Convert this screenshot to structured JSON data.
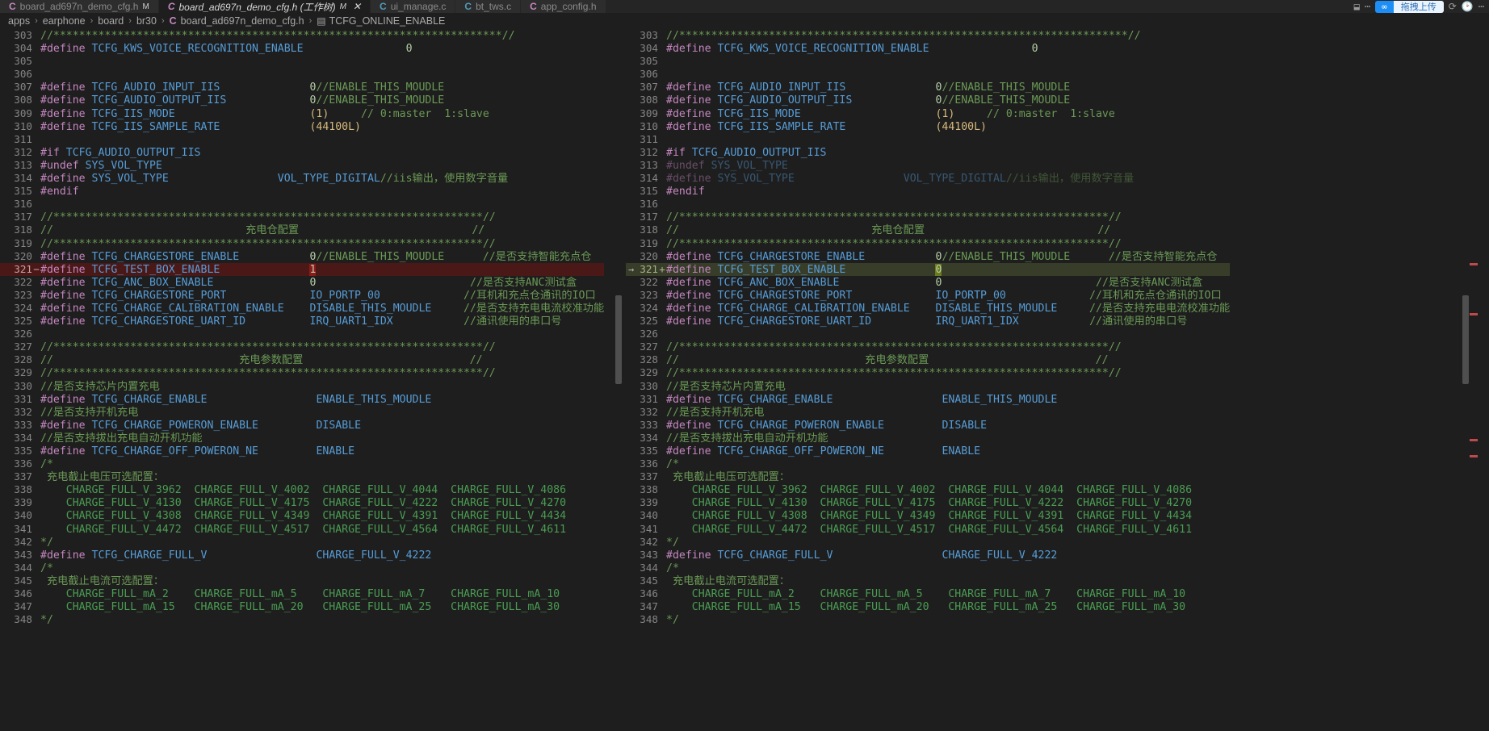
{
  "window": {
    "tabs": [
      {
        "icon": "c-file-icon",
        "label": "board_ad697n_demo_cfg.h",
        "dirty": "M",
        "active": false,
        "closable": false
      },
      {
        "icon": "c-file-icon",
        "label": "board_ad697n_demo_cfg.h (工作树)",
        "dirty": "M",
        "active": true,
        "closable": true,
        "close_label": "✕"
      },
      {
        "icon": "c-file-icon-blue",
        "label": "ui_manage.c",
        "dirty": "",
        "active": false,
        "closable": false
      },
      {
        "icon": "c-file-icon-blue",
        "label": "bt_tws.c",
        "dirty": "",
        "active": false,
        "closable": false
      },
      {
        "icon": "c-file-icon",
        "label": "app_config.h",
        "dirty": "",
        "active": false,
        "closable": false
      }
    ],
    "toolbar": {
      "split_editor_icon": "⬓",
      "more_actions_icon": "⋯",
      "history_icon": "⟳",
      "clock_icon": "🕑",
      "upload_prefix": "∞",
      "upload_label": "拖拽上传"
    }
  },
  "breadcrumb": {
    "separator": "›",
    "items": [
      "apps",
      "earphone",
      "board",
      "br30"
    ],
    "file": "board_ad697n_demo_cfg.h",
    "symbol": "TCFG_ONLINE_ENABLE"
  },
  "diff": {
    "left_title": "board_ad697n_demo_cfg.h",
    "right_title": "board_ad697n_demo_cfg.h (工作树)",
    "changed_line": 321,
    "removed_value": "1",
    "added_value": "0",
    "colors": {
      "deleted_line_bg": "#4b1818",
      "deleted_token_bg": "#8b1b1b",
      "inserted_line_bg": "#373d29",
      "inserted_token_bg": "#6b7a1e",
      "editor_bg": "#1e1e1e",
      "comment": "#6a9955",
      "keyword": "#c586c0",
      "identifier": "#569cd6",
      "number": "#b5cea8",
      "accent_blue": "#1c8ef5"
    }
  },
  "code": {
    "lines": [
      {
        "n": 303,
        "mark": "",
        "tokens": [
          {
            "t": "//**********************************************************************//",
            "c": "cmt"
          }
        ]
      },
      {
        "n": 304,
        "mark": "",
        "tokens": [
          {
            "t": "#define ",
            "c": "kw"
          },
          {
            "t": "TCFG_KWS_VOICE_RECOGNITION_ENABLE",
            "c": "id"
          },
          {
            "t": "                ",
            "c": "plain"
          },
          {
            "t": "0",
            "c": "num"
          }
        ]
      },
      {
        "n": 305,
        "mark": "",
        "tokens": []
      },
      {
        "n": 306,
        "mark": "",
        "tokens": []
      },
      {
        "n": 307,
        "mark": "",
        "tokens": [
          {
            "t": "#define ",
            "c": "kw"
          },
          {
            "t": "TCFG_AUDIO_INPUT_IIS",
            "c": "id"
          },
          {
            "t": "              ",
            "c": "plain"
          },
          {
            "t": "0",
            "c": "num"
          },
          {
            "t": "//ENABLE_THIS_MOUDLE",
            "c": "cmt"
          }
        ]
      },
      {
        "n": 308,
        "mark": "",
        "tokens": [
          {
            "t": "#define ",
            "c": "kw"
          },
          {
            "t": "TCFG_AUDIO_OUTPUT_IIS",
            "c": "id"
          },
          {
            "t": "             ",
            "c": "plain"
          },
          {
            "t": "0",
            "c": "num"
          },
          {
            "t": "//ENABLE_THIS_MOUDLE",
            "c": "cmt"
          }
        ]
      },
      {
        "n": 309,
        "mark": "",
        "tokens": [
          {
            "t": "#define ",
            "c": "kw"
          },
          {
            "t": "TCFG_IIS_MODE",
            "c": "id"
          },
          {
            "t": "                     ",
            "c": "plain"
          },
          {
            "t": "(1)",
            "c": "numy"
          },
          {
            "t": "     ",
            "c": "plain"
          },
          {
            "t": "// 0:master  1:slave",
            "c": "cmt"
          }
        ]
      },
      {
        "n": 310,
        "mark": "",
        "tokens": [
          {
            "t": "#define ",
            "c": "kw"
          },
          {
            "t": "TCFG_IIS_SAMPLE_RATE",
            "c": "id"
          },
          {
            "t": "              ",
            "c": "plain"
          },
          {
            "t": "(44100L)",
            "c": "numy"
          }
        ]
      },
      {
        "n": 311,
        "mark": "",
        "tokens": []
      },
      {
        "n": 312,
        "mark": "",
        "tokens": [
          {
            "t": "#if ",
            "c": "kw"
          },
          {
            "t": "TCFG_AUDIO_OUTPUT_IIS",
            "c": "id"
          }
        ]
      },
      {
        "n": 313,
        "mark": "",
        "tokens": [
          {
            "t": "#undef ",
            "c": "kw"
          },
          {
            "t": "SYS_VOL_TYPE",
            "c": "id"
          }
        ]
      },
      {
        "n": 314,
        "mark": "",
        "tokens": [
          {
            "t": "#define ",
            "c": "kw"
          },
          {
            "t": "SYS_VOL_TYPE",
            "c": "id"
          },
          {
            "t": "                 ",
            "c": "plain"
          },
          {
            "t": "VOL_TYPE_DIGITAL",
            "c": "val"
          },
          {
            "t": "//iis输出，使用数字音量",
            "c": "cmt"
          }
        ]
      },
      {
        "n": 315,
        "mark": "",
        "tokens": [
          {
            "t": "#endif",
            "c": "kw"
          }
        ]
      },
      {
        "n": 316,
        "mark": "",
        "tokens": []
      },
      {
        "n": 317,
        "mark": "",
        "tokens": [
          {
            "t": "//*******************************************************************//",
            "c": "cmt"
          }
        ]
      },
      {
        "n": 318,
        "mark": "",
        "tokens": [
          {
            "t": "//                              充电仓配置                           //",
            "c": "cmt"
          }
        ]
      },
      {
        "n": 319,
        "mark": "",
        "tokens": [
          {
            "t": "//*******************************************************************//",
            "c": "cmt"
          }
        ]
      },
      {
        "n": 320,
        "mark": "",
        "tokens": [
          {
            "t": "#define ",
            "c": "kw"
          },
          {
            "t": "TCFG_CHARGESTORE_ENABLE",
            "c": "id"
          },
          {
            "t": "           ",
            "c": "plain"
          },
          {
            "t": "0",
            "c": "num"
          },
          {
            "t": "//ENABLE_THIS_MOUDLE",
            "c": "cmt"
          },
          {
            "t": "      ",
            "c": "plain"
          },
          {
            "t": "//是否支持智能充点仓",
            "c": "cmt"
          }
        ]
      },
      {
        "n": 321,
        "mark": "del",
        "tokens": [
          {
            "t": "#define ",
            "c": "kw"
          },
          {
            "t": "TCFG_TEST_BOX_ENABLE",
            "c": "id"
          },
          {
            "t": "              ",
            "c": "plain"
          },
          {
            "t": "1",
            "c": "num hl-del"
          }
        ]
      },
      {
        "n": 322,
        "mark": "",
        "tokens": [
          {
            "t": "#define ",
            "c": "kw"
          },
          {
            "t": "TCFG_ANC_BOX_ENABLE",
            "c": "id"
          },
          {
            "t": "               ",
            "c": "plain"
          },
          {
            "t": "0",
            "c": "num"
          },
          {
            "t": "                        ",
            "c": "plain"
          },
          {
            "t": "//是否支持ANC测试盒",
            "c": "cmt"
          }
        ]
      },
      {
        "n": 323,
        "mark": "",
        "tokens": [
          {
            "t": "#define ",
            "c": "kw"
          },
          {
            "t": "TCFG_CHARGESTORE_PORT",
            "c": "id"
          },
          {
            "t": "             ",
            "c": "plain"
          },
          {
            "t": "IO_PORTP_00",
            "c": "val"
          },
          {
            "t": "             ",
            "c": "plain"
          },
          {
            "t": "//耳机和充点仓通讯的IO口",
            "c": "cmt"
          }
        ]
      },
      {
        "n": 324,
        "mark": "",
        "tokens": [
          {
            "t": "#define ",
            "c": "kw"
          },
          {
            "t": "TCFG_CHARGE_CALIBRATION_ENABLE",
            "c": "id"
          },
          {
            "t": "    ",
            "c": "plain"
          },
          {
            "t": "DISABLE_THIS_MOUDLE",
            "c": "val"
          },
          {
            "t": "     ",
            "c": "plain"
          },
          {
            "t": "//是否支持充电电流校准功能",
            "c": "cmt"
          }
        ]
      },
      {
        "n": 325,
        "mark": "",
        "tokens": [
          {
            "t": "#define ",
            "c": "kw"
          },
          {
            "t": "TCFG_CHARGESTORE_UART_ID",
            "c": "id"
          },
          {
            "t": "          ",
            "c": "plain"
          },
          {
            "t": "IRQ_UART1_IDX",
            "c": "val"
          },
          {
            "t": "           ",
            "c": "plain"
          },
          {
            "t": "//通讯使用的串口号",
            "c": "cmt"
          }
        ]
      },
      {
        "n": 326,
        "mark": "",
        "tokens": []
      },
      {
        "n": 327,
        "mark": "",
        "tokens": [
          {
            "t": "//*******************************************************************//",
            "c": "cmt"
          }
        ]
      },
      {
        "n": 328,
        "mark": "",
        "tokens": [
          {
            "t": "//                             充电参数配置                          //",
            "c": "cmt"
          }
        ]
      },
      {
        "n": 329,
        "mark": "",
        "tokens": [
          {
            "t": "//*******************************************************************//",
            "c": "cmt"
          }
        ]
      },
      {
        "n": 330,
        "mark": "",
        "tokens": [
          {
            "t": "//是否支持芯片内置充电",
            "c": "cmt"
          }
        ]
      },
      {
        "n": 331,
        "mark": "",
        "tokens": [
          {
            "t": "#define ",
            "c": "kw"
          },
          {
            "t": "TCFG_CHARGE_ENABLE",
            "c": "id"
          },
          {
            "t": "                 ",
            "c": "plain"
          },
          {
            "t": "ENABLE_THIS_MOUDLE",
            "c": "val"
          }
        ]
      },
      {
        "n": 332,
        "mark": "",
        "tokens": [
          {
            "t": "//是否支持开机充电",
            "c": "cmt"
          }
        ]
      },
      {
        "n": 333,
        "mark": "",
        "tokens": [
          {
            "t": "#define ",
            "c": "kw"
          },
          {
            "t": "TCFG_CHARGE_POWERON_ENABLE",
            "c": "id"
          },
          {
            "t": "         ",
            "c": "plain"
          },
          {
            "t": "DISABLE",
            "c": "val"
          }
        ]
      },
      {
        "n": 334,
        "mark": "",
        "tokens": [
          {
            "t": "//是否支持拔出充电自动开机功能",
            "c": "cmt"
          }
        ]
      },
      {
        "n": 335,
        "mark": "",
        "tokens": [
          {
            "t": "#define ",
            "c": "kw"
          },
          {
            "t": "TCFG_CHARGE_OFF_POWERON_NE",
            "c": "id"
          },
          {
            "t": "         ",
            "c": "plain"
          },
          {
            "t": "ENABLE",
            "c": "val"
          }
        ]
      },
      {
        "n": 336,
        "mark": "",
        "tokens": [
          {
            "t": "/*",
            "c": "cmt"
          }
        ]
      },
      {
        "n": 337,
        "mark": "",
        "tokens": [
          {
            "t": " 充电截止电压可选配置：",
            "c": "cmt"
          }
        ]
      },
      {
        "n": 338,
        "mark": "",
        "tokens": [
          {
            "t": "    CHARGE_FULL_V_3962  CHARGE_FULL_V_4002  CHARGE_FULL_V_4044  CHARGE_FULL_V_4086",
            "c": "cfv"
          }
        ]
      },
      {
        "n": 339,
        "mark": "",
        "tokens": [
          {
            "t": "    CHARGE_FULL_V_4130  CHARGE_FULL_V_4175  CHARGE_FULL_V_4222  CHARGE_FULL_V_4270",
            "c": "cfv"
          }
        ]
      },
      {
        "n": 340,
        "mark": "",
        "tokens": [
          {
            "t": "    CHARGE_FULL_V_4308  CHARGE_FULL_V_4349  CHARGE_FULL_V_4391  CHARGE_FULL_V_4434",
            "c": "cfv"
          }
        ]
      },
      {
        "n": 341,
        "mark": "",
        "tokens": [
          {
            "t": "    CHARGE_FULL_V_4472  CHARGE_FULL_V_4517  CHARGE_FULL_V_4564  CHARGE_FULL_V_4611",
            "c": "cfv"
          }
        ]
      },
      {
        "n": 342,
        "mark": "",
        "tokens": [
          {
            "t": "*/",
            "c": "cmt"
          }
        ]
      },
      {
        "n": 343,
        "mark": "",
        "tokens": [
          {
            "t": "#define ",
            "c": "kw"
          },
          {
            "t": "TCFG_CHARGE_FULL_V",
            "c": "id"
          },
          {
            "t": "                 ",
            "c": "plain"
          },
          {
            "t": "CHARGE_FULL_V_4222",
            "c": "val"
          }
        ]
      },
      {
        "n": 344,
        "mark": "",
        "tokens": [
          {
            "t": "/*",
            "c": "cmt"
          }
        ]
      },
      {
        "n": 345,
        "mark": "",
        "tokens": [
          {
            "t": " 充电截止电流可选配置：",
            "c": "cmt"
          }
        ]
      },
      {
        "n": 346,
        "mark": "",
        "tokens": [
          {
            "t": "    CHARGE_FULL_mA_2    CHARGE_FULL_mA_5    CHARGE_FULL_mA_7    CHARGE_FULL_mA_10",
            "c": "cfv"
          }
        ]
      },
      {
        "n": 347,
        "mark": "",
        "tokens": [
          {
            "t": "    CHARGE_FULL_mA_15   CHARGE_FULL_mA_20   CHARGE_FULL_mA_25   CHARGE_FULL_mA_30",
            "c": "cfv"
          }
        ]
      },
      {
        "n": 348,
        "mark": "",
        "tokens": [
          {
            "t": "*/",
            "c": "cmt"
          }
        ]
      }
    ],
    "right_overrides": {
      "313": {
        "dim": true
      },
      "314": {
        "dim": true
      },
      "321": {
        "mark": "ins",
        "arrow": "→",
        "value": "0"
      }
    }
  }
}
